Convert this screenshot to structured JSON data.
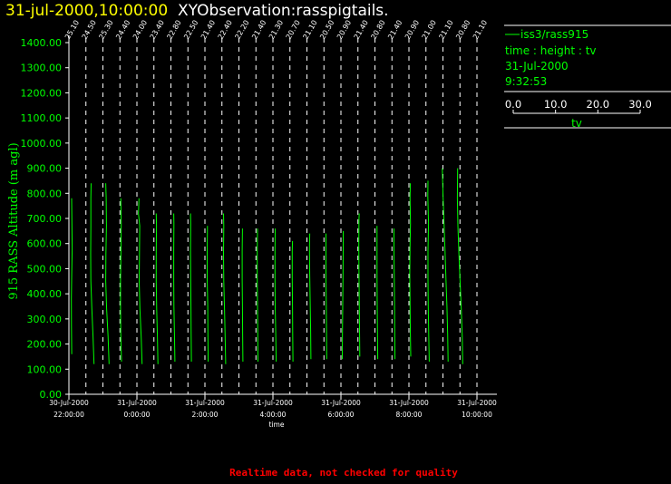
{
  "header": {
    "date_time": "31-jul-2000,10:00:00",
    "title": "XYObservation:rasspigtails."
  },
  "legend": {
    "series_label": "iss3/rass915",
    "line2": "time : height : tv",
    "line3": "31-Jul-2000",
    "line4": "9:32:53",
    "scale_ticks": [
      "0.0",
      "10.0",
      "20.0",
      "30.0"
    ],
    "scale_label": "tv"
  },
  "footer": {
    "text": "Realtime data, not checked for quality"
  },
  "colors": {
    "series": "#00ff00",
    "header_date": "#ffff00",
    "footer": "#ff0000",
    "background": "#000000"
  },
  "chart_data": {
    "type": "line",
    "title": "XYObservation:rasspigtails.",
    "xlabel": "time",
    "ylabel": "915 RASS Altitude (m agl)",
    "ylim": [
      0,
      1400
    ],
    "y_ticks": [
      "0.00",
      "100.00",
      "200.00",
      "300.00",
      "400.00",
      "500.00",
      "600.00",
      "700.00",
      "800.00",
      "900.00",
      "1000.00",
      "1100.00",
      "1200.00",
      "1300.00",
      "1400.00"
    ],
    "x_range": [
      "2000-07-30 22:00",
      "2000-07-31 10:00"
    ],
    "x_ticks": [
      {
        "date": "30-Jul-2000",
        "time": "22:00:00"
      },
      {
        "date": "31-Jul-2000",
        "time": "0:00:00"
      },
      {
        "date": "31-Jul-2000",
        "time": "2:00:00"
      },
      {
        "date": "31-Jul-2000",
        "time": "4:00:00"
      },
      {
        "date": "31-Jul-2000",
        "time": "6:00:00"
      },
      {
        "date": "31-Jul-2000",
        "time": "8:00:00"
      },
      {
        "date": "31-Jul-2000",
        "time": "10:00:00"
      }
    ],
    "grid": false,
    "legend_position": "right",
    "tv_scale": [
      0,
      30
    ],
    "profiles": [
      {
        "time": "2000-07-30 22:00",
        "tv_label": "25.10",
        "points": [
          [
            17.0,
            160
          ],
          [
            16.5,
            270
          ],
          [
            16.3,
            380
          ],
          [
            17.0,
            480
          ],
          [
            18.0,
            580
          ],
          [
            17.5,
            680
          ],
          [
            16.8,
            780
          ]
        ]
      },
      {
        "time": "2000-07-30 22:30",
        "tv_label": "24.50",
        "points": [
          [
            28.0,
            120
          ],
          [
            26.0,
            230
          ],
          [
            23.5,
            340
          ],
          [
            21.5,
            450
          ],
          [
            21.0,
            560
          ],
          [
            21.5,
            670
          ],
          [
            21.5,
            780
          ],
          [
            22.0,
            840
          ]
        ]
      },
      {
        "time": "2000-07-30 23:00",
        "tv_label": "25.30",
        "points": [
          [
            24.0,
            120
          ],
          [
            22.0,
            230
          ],
          [
            19.0,
            340
          ],
          [
            17.0,
            450
          ],
          [
            17.5,
            560
          ],
          [
            18.5,
            670
          ],
          [
            18.0,
            780
          ],
          [
            17.0,
            840
          ]
        ]
      },
      {
        "time": "2000-07-30 23:30",
        "tv_label": "24.40",
        "points": [
          [
            14.5,
            130
          ],
          [
            13.0,
            240
          ],
          [
            12.5,
            350
          ],
          [
            12.5,
            460
          ],
          [
            13.5,
            570
          ],
          [
            14.0,
            680
          ],
          [
            13.0,
            780
          ]
        ]
      },
      {
        "time": "2000-07-31 00:00",
        "tv_label": "24.00",
        "points": [
          [
            22.0,
            120
          ],
          [
            20.0,
            230
          ],
          [
            17.5,
            340
          ],
          [
            16.0,
            450
          ],
          [
            16.5,
            560
          ],
          [
            17.0,
            670
          ],
          [
            14.5,
            720
          ],
          [
            15.5,
            780
          ]
        ]
      },
      {
        "time": "2000-07-31 00:30",
        "tv_label": "23.40",
        "points": [
          [
            19.5,
            120
          ],
          [
            18.5,
            230
          ],
          [
            17.0,
            340
          ],
          [
            16.0,
            450
          ],
          [
            16.0,
            560
          ],
          [
            16.5,
            670
          ],
          [
            16.0,
            720
          ]
        ]
      },
      {
        "time": "2000-07-31 01:00",
        "tv_label": "22.80",
        "points": [
          [
            19.5,
            130
          ],
          [
            18.5,
            240
          ],
          [
            17.5,
            350
          ],
          [
            17.0,
            460
          ],
          [
            17.0,
            570
          ],
          [
            17.5,
            680
          ],
          [
            17.0,
            720
          ]
        ]
      },
      {
        "time": "2000-07-31 01:30",
        "tv_label": "22.50",
        "points": [
          [
            18.5,
            130
          ],
          [
            18.0,
            240
          ],
          [
            17.5,
            350
          ],
          [
            17.0,
            460
          ],
          [
            16.5,
            570
          ],
          [
            17.0,
            680
          ],
          [
            16.5,
            720
          ]
        ]
      },
      {
        "time": "2000-07-31 02:00",
        "tv_label": "21.40",
        "points": [
          [
            18.0,
            130
          ],
          [
            17.5,
            240
          ],
          [
            17.0,
            350
          ],
          [
            16.0,
            460
          ],
          [
            16.0,
            570
          ],
          [
            16.5,
            670
          ]
        ]
      },
      {
        "time": "2000-07-31 02:30",
        "tv_label": "22.40",
        "points": [
          [
            19.0,
            120
          ],
          [
            18.0,
            230
          ],
          [
            16.5,
            340
          ],
          [
            15.0,
            450
          ],
          [
            14.5,
            560
          ],
          [
            15.0,
            670
          ],
          [
            14.5,
            720
          ]
        ]
      },
      {
        "time": "2000-07-31 03:00",
        "tv_label": "22.20",
        "points": [
          [
            19.5,
            130
          ],
          [
            19.0,
            240
          ],
          [
            18.5,
            350
          ],
          [
            18.0,
            460
          ],
          [
            18.0,
            570
          ],
          [
            18.5,
            660
          ]
        ]
      },
      {
        "time": "2000-07-31 03:30",
        "tv_label": "21.40",
        "points": [
          [
            15.5,
            130
          ],
          [
            15.0,
            240
          ],
          [
            14.5,
            350
          ],
          [
            14.0,
            460
          ],
          [
            14.0,
            570
          ],
          [
            14.5,
            660
          ]
        ]
      },
      {
        "time": "2000-07-31 04:00",
        "tv_label": "21.30",
        "points": [
          [
            18.0,
            130
          ],
          [
            17.0,
            240
          ],
          [
            16.0,
            350
          ],
          [
            15.5,
            460
          ],
          [
            15.5,
            570
          ],
          [
            16.0,
            660
          ]
        ]
      },
      {
        "time": "2000-07-31 04:30",
        "tv_label": "20.70",
        "points": [
          [
            17.5,
            130
          ],
          [
            17.0,
            240
          ],
          [
            16.5,
            350
          ],
          [
            16.0,
            460
          ],
          [
            16.0,
            570
          ],
          [
            16.5,
            610
          ]
        ]
      },
      {
        "time": "2000-07-31 05:00",
        "tv_label": "21.10",
        "points": [
          [
            19.5,
            140
          ],
          [
            19.0,
            250
          ],
          [
            18.0,
            360
          ],
          [
            17.0,
            470
          ],
          [
            16.5,
            580
          ],
          [
            17.0,
            640
          ]
        ]
      },
      {
        "time": "2000-07-31 05:30",
        "tv_label": "20.50",
        "points": [
          [
            17.0,
            140
          ],
          [
            16.5,
            250
          ],
          [
            16.0,
            360
          ],
          [
            15.5,
            470
          ],
          [
            15.5,
            580
          ],
          [
            15.5,
            640
          ]
        ]
      },
      {
        "time": "2000-07-31 06:00",
        "tv_label": "20.90",
        "points": [
          [
            14.0,
            140
          ],
          [
            14.5,
            250
          ],
          [
            15.0,
            360
          ],
          [
            15.5,
            470
          ],
          [
            16.0,
            580
          ],
          [
            16.0,
            650
          ]
        ]
      },
      {
        "time": "2000-07-31 06:30",
        "tv_label": "21.40",
        "points": [
          [
            15.0,
            150
          ],
          [
            14.5,
            260
          ],
          [
            14.0,
            370
          ],
          [
            13.5,
            480
          ],
          [
            13.0,
            590
          ],
          [
            13.5,
            700
          ],
          [
            14.0,
            720
          ]
        ]
      },
      {
        "time": "2000-07-31 07:00",
        "tv_label": "20.80",
        "points": [
          [
            17.0,
            140
          ],
          [
            16.5,
            250
          ],
          [
            16.0,
            360
          ],
          [
            15.5,
            470
          ],
          [
            15.5,
            580
          ],
          [
            15.5,
            670
          ]
        ]
      },
      {
        "time": "2000-07-31 07:30",
        "tv_label": "21.40",
        "points": [
          [
            17.5,
            140
          ],
          [
            17.0,
            250
          ],
          [
            16.5,
            360
          ],
          [
            16.0,
            470
          ],
          [
            15.5,
            580
          ],
          [
            15.5,
            660
          ]
        ]
      },
      {
        "time": "2000-07-31 08:00",
        "tv_label": "20.90",
        "points": [
          [
            15.0,
            150
          ],
          [
            14.0,
            260
          ],
          [
            13.5,
            370
          ],
          [
            13.0,
            480
          ],
          [
            13.5,
            590
          ],
          [
            14.5,
            680
          ],
          [
            13.5,
            780
          ],
          [
            14.0,
            840
          ]
        ]
      },
      {
        "time": "2000-07-31 08:30",
        "tv_label": "21.00",
        "points": [
          [
            18.0,
            130
          ],
          [
            17.0,
            240
          ],
          [
            16.0,
            350
          ],
          [
            15.5,
            460
          ],
          [
            15.5,
            570
          ],
          [
            16.5,
            680
          ],
          [
            15.0,
            790
          ],
          [
            15.5,
            850
          ]
        ]
      },
      {
        "time": "2000-07-31 09:00",
        "tv_label": "21.10",
        "points": [
          [
            22.0,
            130
          ],
          [
            21.0,
            240
          ],
          [
            19.5,
            350
          ],
          [
            17.5,
            460
          ],
          [
            15.5,
            570
          ],
          [
            13.5,
            680
          ],
          [
            11.5,
            790
          ],
          [
            10.0,
            900
          ]
        ]
      },
      {
        "time": "2000-07-31 09:30",
        "tv_label": "20.80",
        "points": [
          [
            17.0,
            120
          ],
          [
            16.0,
            230
          ],
          [
            14.0,
            340
          ],
          [
            11.5,
            450
          ],
          [
            9.0,
            560
          ],
          [
            7.0,
            670
          ],
          [
            6.0,
            780
          ],
          [
            6.5,
            900
          ]
        ]
      },
      {
        "time": "2000-07-31 10:00",
        "tv_label": "21.10",
        "points": []
      }
    ]
  }
}
